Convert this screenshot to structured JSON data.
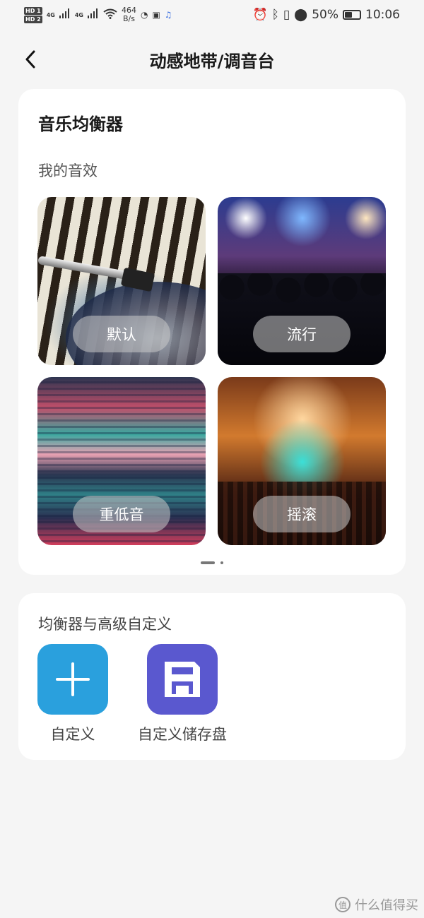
{
  "status_bar": {
    "hd1": "HD 1",
    "hd2": "HD 2",
    "net1": "4G",
    "net2": "4G",
    "speed_value": "464",
    "speed_unit": "B/s",
    "battery_percent": "50%",
    "time": "10:06"
  },
  "header": {
    "title": "动感地带/调音台"
  },
  "equalizer": {
    "title": "音乐均衡器",
    "subtitle": "我的音效",
    "presets": [
      {
        "label": "默认"
      },
      {
        "label": "流行"
      },
      {
        "label": "重低音"
      },
      {
        "label": "摇滚"
      }
    ],
    "pager": {
      "pages": 2,
      "current": 1
    }
  },
  "advanced": {
    "title": "均衡器与高级自定义",
    "items": [
      {
        "label": "自定义",
        "icon": "plus-icon",
        "color": "#2aa0dd"
      },
      {
        "label": "自定义储存盘",
        "icon": "save-disk-icon",
        "color": "#5a58cf"
      }
    ]
  },
  "watermark": {
    "logo": "值",
    "text": "什么值得买"
  }
}
